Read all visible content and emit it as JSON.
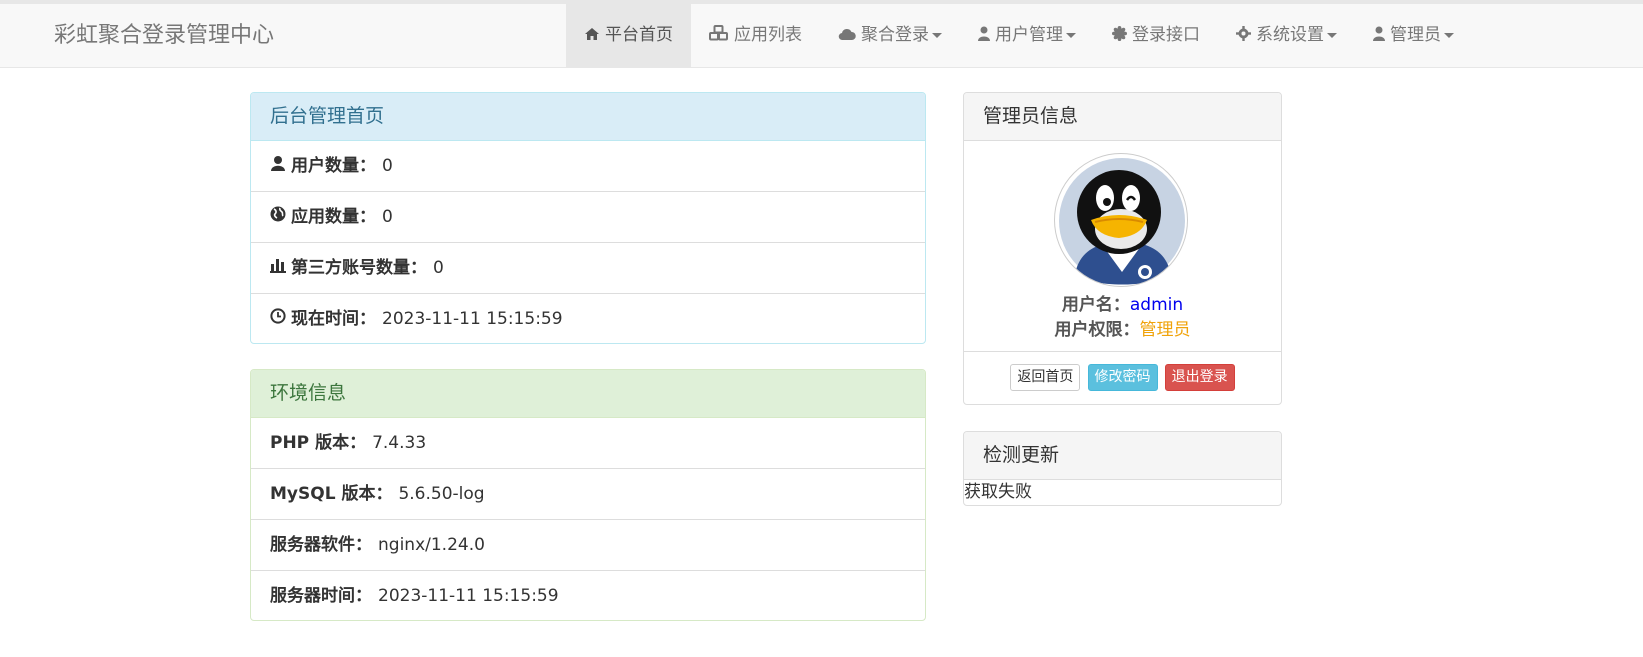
{
  "brand": "彩虹聚合登录管理中心",
  "nav": {
    "home": "平台首页",
    "apps": "应用列表",
    "login": "聚合登录",
    "users": "用户管理",
    "api": "登录接口",
    "settings": "系统设置",
    "admin": "管理员"
  },
  "dashboard": {
    "title": "后台管理首页",
    "rows": [
      {
        "label": "用户数量：",
        "value": "0"
      },
      {
        "label": "应用数量：",
        "value": "0"
      },
      {
        "label": "第三方账号数量：",
        "value": "0"
      },
      {
        "label": "现在时间：",
        "value": "2023-11-11 15:15:59"
      }
    ]
  },
  "env": {
    "title": "环境信息",
    "rows": [
      {
        "label": "PHP 版本：",
        "value": "7.4.33"
      },
      {
        "label": "MySQL 版本：",
        "value": "5.6.50-log"
      },
      {
        "label": "服务器软件：",
        "value": "nginx/1.24.0"
      },
      {
        "label": "服务器时间：",
        "value": "2023-11-11 15:15:59"
      }
    ]
  },
  "admin_info": {
    "title": "管理员信息",
    "username_label": "用户名：",
    "username": "admin",
    "role_label": "用户权限：",
    "role": "管理员",
    "buttons": {
      "home": "返回首页",
      "password": "修改密码",
      "logout": "退出登录"
    }
  },
  "update": {
    "title": "检测更新",
    "status": "获取失败"
  },
  "colors": {
    "username": "#0000ee",
    "role": "#f0a30a",
    "info_heading": "#d9edf7",
    "success_heading": "#dff0d8",
    "btn_info": "#5bc0de",
    "btn_danger": "#d9534f"
  }
}
